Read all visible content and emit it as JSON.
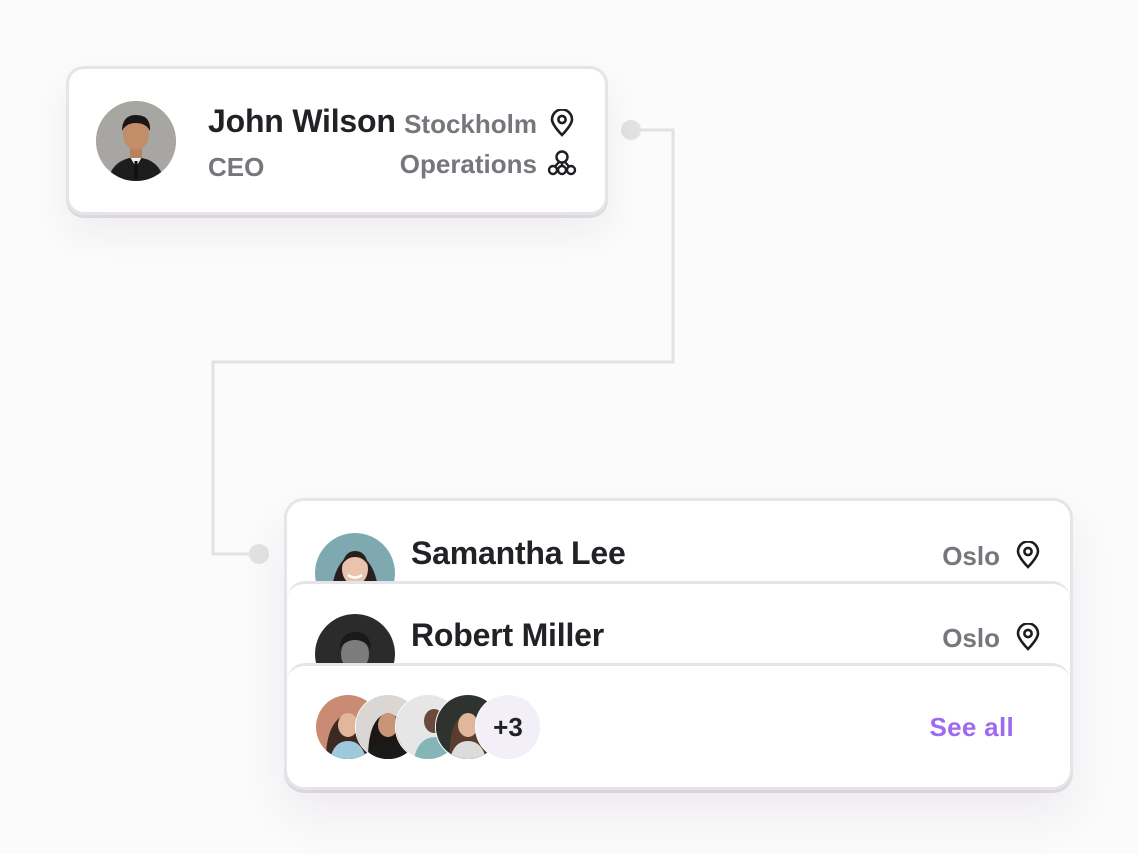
{
  "ceo": {
    "name": "John Wilson",
    "title": "CEO",
    "location": "Stockholm",
    "department": "Operations"
  },
  "reports": [
    {
      "name": "Samantha Lee",
      "location": "Oslo"
    },
    {
      "name": "Robert Miller",
      "location": "Oslo"
    }
  ],
  "team_summary": {
    "more_count": "+3",
    "see_all_label": "See all"
  },
  "colors": {
    "accent": "#9e6bf0",
    "connector": "#e2e1e4",
    "border": "#e6e4e8",
    "muted_text": "#77767c"
  },
  "icons": [
    "location-pin-icon",
    "department-icon"
  ]
}
